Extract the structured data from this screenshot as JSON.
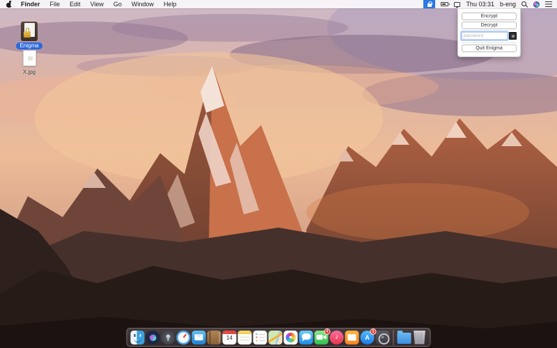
{
  "menubar": {
    "items": [
      "Finder",
      "File",
      "Edit",
      "View",
      "Go",
      "Window",
      "Help"
    ],
    "status": {
      "time": "Thu 03:31",
      "user": "b-eng"
    },
    "icons": [
      "apple-logo",
      "enigma-lock-menubar",
      "battery",
      "display",
      "spotlight-search",
      "siri",
      "notification-center"
    ]
  },
  "enigma_menu": {
    "encrypt_label": "Encrypt",
    "decrypt_label": "Decrypt",
    "password_placeholder": "password",
    "password_value": "",
    "key_button": "key-icon",
    "quit_label": "Quit Enigma"
  },
  "desktop": {
    "icons": [
      {
        "label": "Enigma",
        "selected": true,
        "kind": "app-with-lock"
      },
      {
        "label": "X.jpg",
        "selected": false,
        "kind": "document"
      }
    ]
  },
  "dock": {
    "items": [
      "Finder",
      "Siri",
      "Launchpad",
      "Safari",
      "Mail",
      "Contacts",
      "Calendar",
      "Notes",
      "Reminders",
      "Maps",
      "Photos",
      "Messages",
      "FaceTime",
      "iTunes",
      "iBooks",
      "App Store",
      "System Preferences",
      "Downloads",
      "Trash"
    ],
    "calendar_day": "14",
    "itunes_glyph": "♪",
    "appstore_glyph": "A",
    "facetime_badge": "4",
    "appstore_badge": "1"
  },
  "colors": {
    "selection_blue": "#2a69dd",
    "menubar_active_blue": "#2a78e4",
    "badge_red": "#e8362e"
  }
}
